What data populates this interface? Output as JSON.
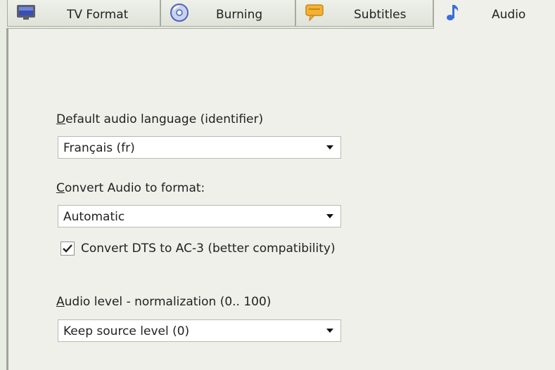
{
  "tabs": [
    {
      "label": "TV Format",
      "icon": "tv-monitor-icon"
    },
    {
      "label": "Burning",
      "icon": "disc-icon"
    },
    {
      "label": "Subtitles",
      "icon": "speech-bubble-icon"
    },
    {
      "label": "Audio",
      "icon": "music-note-icon",
      "active": true
    }
  ],
  "default_audio_language": {
    "label_accel": "D",
    "label_rest": "efault audio language (identifier)",
    "value": "Français (fr)"
  },
  "convert_format": {
    "label_accel": "C",
    "label_rest": "onvert Audio to format:",
    "value": "Automatic"
  },
  "convert_dts": {
    "label": "Convert DTS to AC-3 (better compatibility)",
    "checked": true
  },
  "audio_level": {
    "label_accel": "A",
    "label_rest": "udio level - normalization (0.. 100)",
    "value": "Keep source level (0)"
  }
}
